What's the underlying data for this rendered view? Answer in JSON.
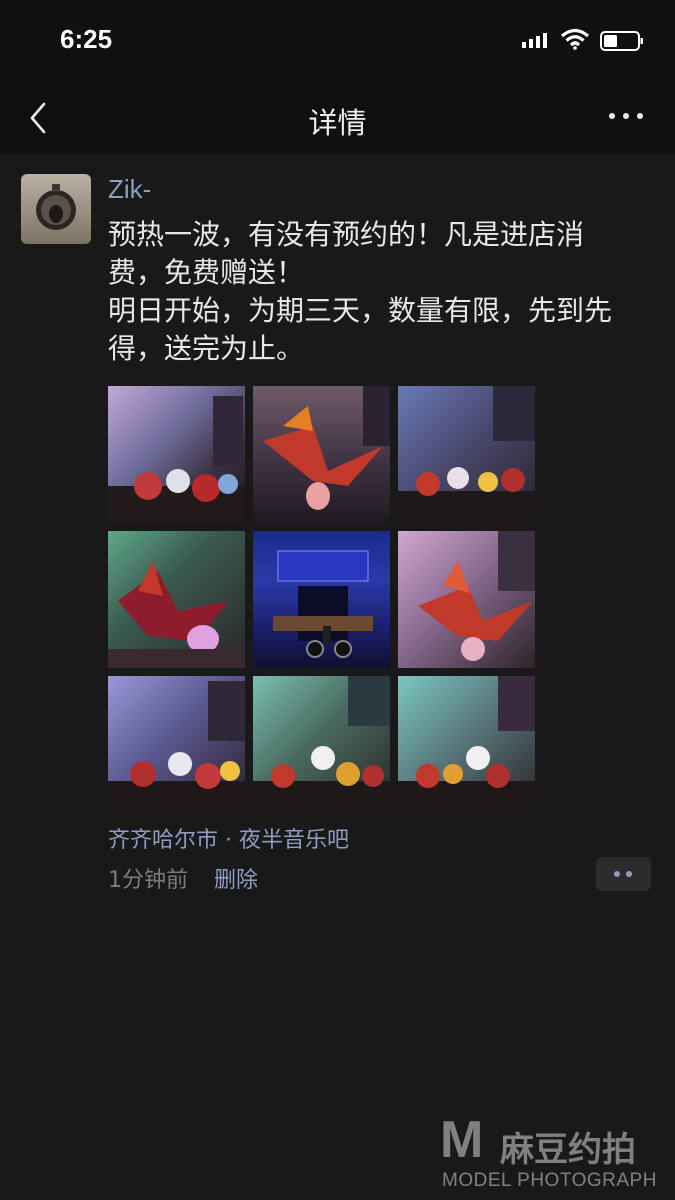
{
  "status_bar": {
    "time": "6:25",
    "signal_icon": "signal-bars-icon",
    "wifi_icon": "wifi-icon",
    "battery_icon": "battery-icon"
  },
  "nav": {
    "title": "详情",
    "back_icon": "chevron-left-icon",
    "more_icon": "more-dots-icon"
  },
  "post": {
    "username": "Zik-",
    "content_lines": [
      "预热一波，有没有预约的！凡是进店消",
      "费，免费赠送！",
      "明日开始，为期三天，数量有限，先到先",
      "得，送完为止。"
    ],
    "photos": [
      "flower-bouquets-photo-1",
      "origami-bird-photo-1",
      "flower-bouquets-photo-2",
      "origami-bird-lamp-photo",
      "storefront-night-photo",
      "origami-bird-photo-2",
      "flower-bouquets-photo-3",
      "flower-bouquets-photo-4",
      "flower-bouquets-photo-5"
    ],
    "location": "齐齐哈尔市 · 夜半音乐吧",
    "time_ago": "1分钟前",
    "delete_label": "删除",
    "comment_icon": "comment-dots-icon"
  },
  "watermark": {
    "logo": "M",
    "cn": "麻豆约拍",
    "en": "MODEL PHOTOGRAPH"
  }
}
